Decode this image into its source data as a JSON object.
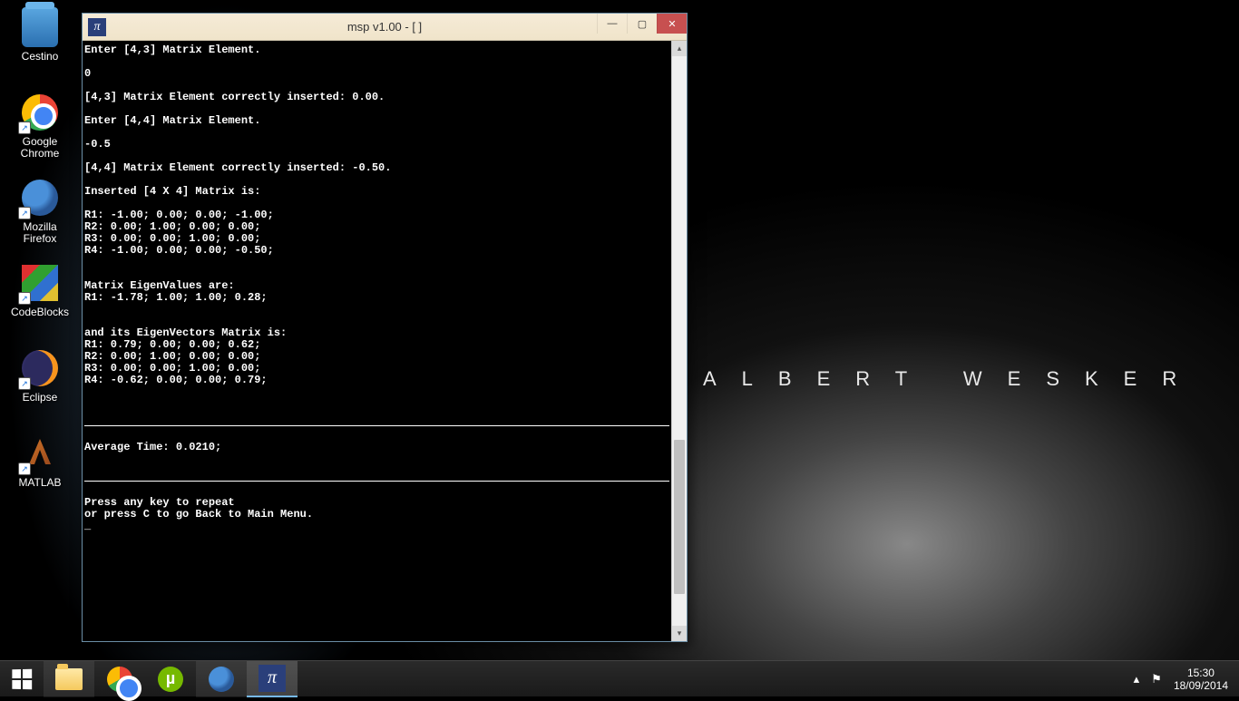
{
  "wallpaper": {
    "text": "ALBERT WESKER"
  },
  "desktop_icons": {
    "cestino": "Cestino",
    "chrome": "Google Chrome",
    "firefox": "Mozilla Firefox",
    "codeblocks": "CodeBlocks",
    "eclipse": "Eclipse",
    "matlab": "MATLAB"
  },
  "window": {
    "title": "msp v1.00 - [  ]"
  },
  "terminal": {
    "l01": "Enter [4,3] Matrix Element.",
    "l02": "",
    "l03": "0",
    "l04": "",
    "l05": "[4,3] Matrix Element correctly inserted: 0.00.",
    "l06": "",
    "l07": "Enter [4,4] Matrix Element.",
    "l08": "",
    "l09": "-0.5",
    "l10": "",
    "l11": "[4,4] Matrix Element correctly inserted: -0.50.",
    "l12": "",
    "l13": "Inserted [4 X 4] Matrix is:",
    "l14": "",
    "l15": "R1: -1.00; 0.00; 0.00; -1.00;",
    "l16": "R2: 0.00; 1.00; 0.00; 0.00;",
    "l17": "R3: 0.00; 0.00; 1.00; 0.00;",
    "l18": "R4: -1.00; 0.00; 0.00; -0.50;",
    "l19": "",
    "l20": "",
    "l21": "Matrix EigenValues are:",
    "l22": "R1: -1.78; 1.00; 1.00; 0.28;",
    "l23": "",
    "l24": "",
    "l25": "and its EigenVectors Matrix is:",
    "l26": "R1: 0.79; 0.00; 0.00; 0.62;",
    "l27": "R2: 0.00; 1.00; 0.00; 0.00;",
    "l28": "R3: 0.00; 0.00; 1.00; 0.00;",
    "l29": "R4: -0.62; 0.00; 0.00; 0.79;",
    "avg": "Average Time: 0.0210;",
    "p1": "Press any key to repeat",
    "p2": "or press C to go Back to Main Menu.",
    "cursor": "_"
  },
  "tray": {
    "time": "15:30",
    "date": "18/09/2014"
  }
}
